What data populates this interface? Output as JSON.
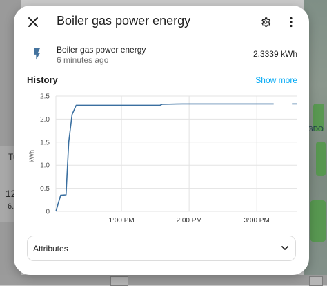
{
  "dialog": {
    "title": "Boiler gas power energy"
  },
  "entity": {
    "name": "Boiler gas power energy",
    "last_changed": "6 minutes ago",
    "value": "2.3339 kWh",
    "icon": "flash-icon"
  },
  "history": {
    "label": "History",
    "show_more": "Show more"
  },
  "attributes": {
    "label": "Attributes"
  },
  "background": {
    "left_texts": [
      "Tu",
      "12",
      "6."
    ],
    "map_texts": [
      "GDO"
    ]
  },
  "colors": {
    "accent": "#03a9f4",
    "series_line": "#3a6fa0",
    "icon": "#44739e"
  },
  "chart_data": {
    "type": "line",
    "ylabel": "kWh",
    "ylim": [
      0,
      2.5
    ],
    "y_ticks": [
      "0",
      "0.5",
      "1.0",
      "1.5",
      "2.0",
      "2.5"
    ],
    "x_ticks": [
      "1:00 PM",
      "2:00 PM",
      "3:00 PM"
    ],
    "x_tick_hours": [
      13,
      14,
      15
    ],
    "x_range_hours": [
      12.03,
      15.6
    ],
    "series": [
      {
        "points": [
          [
            12.03,
            0.0
          ],
          [
            12.1,
            0.35
          ],
          [
            12.18,
            0.36
          ],
          [
            12.22,
            1.5
          ],
          [
            12.27,
            2.1
          ],
          [
            12.33,
            2.3
          ],
          [
            12.5,
            2.3
          ],
          [
            13.0,
            2.3
          ],
          [
            13.5,
            2.3
          ],
          [
            13.57,
            2.3
          ],
          [
            13.6,
            2.32
          ],
          [
            13.9,
            2.33
          ],
          [
            14.5,
            2.33
          ],
          [
            15.0,
            2.33
          ],
          [
            15.25,
            2.33
          ]
        ]
      },
      {
        "points": [
          [
            15.52,
            2.33
          ],
          [
            15.6,
            2.33
          ]
        ]
      }
    ]
  }
}
